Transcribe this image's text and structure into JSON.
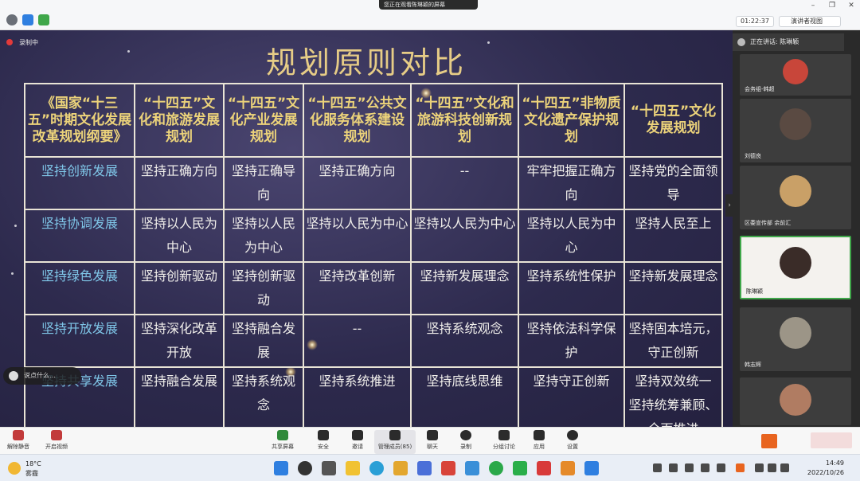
{
  "viewing_banner": "您正在观看陈琳颖的屏幕",
  "timer": "01:22:37",
  "view_mode": "演讲者视图",
  "recording": "录制中",
  "slide": {
    "title": "规划原则对比",
    "headers": [
      "《国家“十三五”时期文化发展改革规划纲要》",
      "“十四五”文化和旅游发展规划",
      "“十四五”文化产业发展规划",
      "“十四五”公共文化服务体系建设规划",
      "“十四五”文化和旅游科技创新规划",
      "“十四五”非物质文化遗产保护规划",
      "“十四五”文化发展规划"
    ],
    "rows": [
      [
        "坚持创新发展",
        "坚持正确方向",
        "坚持正确导向",
        "坚持正确方向",
        "--",
        "牢牢把握正确方向",
        "坚持党的全面领导"
      ],
      [
        "坚持协调发展",
        "坚持以人民为中心",
        "坚持以人民为中心",
        "坚持以人民为中心",
        "坚持以人民为中心",
        "坚持以人民为中心",
        "坚持人民至上"
      ],
      [
        "坚持绿色发展",
        "坚持创新驱动",
        "坚持创新驱动",
        "坚持改革创新",
        "坚持新发展理念",
        "坚持系统性保护",
        "坚持新发展理念"
      ],
      [
        "坚持开放发展",
        "坚持深化改革开放",
        "坚持融合发展",
        "--",
        "坚持系统观念",
        "坚持依法科学保护",
        "坚持固本培元，守正创新"
      ],
      [
        "坚持共享发展",
        "坚持融合发展",
        "坚持系统观念",
        "坚持系统推进",
        "坚持底线思维",
        "坚持守正创新",
        "坚持双效统一 坚持统筹兼顾、全面推进"
      ]
    ]
  },
  "chat_pill": "说点什么…",
  "speaking": "正在讲话: 陈琳颖",
  "participants": [
    {
      "name": "会务组-韩超"
    },
    {
      "name": "刘德良"
    },
    {
      "name": "区委宣传部 余前汇"
    },
    {
      "name": "陈琳颖"
    },
    {
      "name": "韩志辉"
    },
    {
      "name": ""
    }
  ],
  "toolbar_left": [
    {
      "label": "解除静音",
      "icon": "mic-muted-icon"
    },
    {
      "label": "开启视频",
      "icon": "video-off-icon"
    }
  ],
  "toolbar_center": [
    {
      "label": "共享屏幕",
      "icon": "share-screen-icon"
    },
    {
      "label": "安全",
      "icon": "shield-icon"
    },
    {
      "label": "邀请",
      "icon": "invite-icon"
    },
    {
      "label": "管理成员(85)",
      "icon": "members-icon"
    },
    {
      "label": "聊天",
      "icon": "chat-icon"
    },
    {
      "label": "录制",
      "icon": "record-icon"
    },
    {
      "label": "分组讨论",
      "icon": "breakout-icon"
    },
    {
      "label": "应用",
      "icon": "apps-icon"
    },
    {
      "label": "设置",
      "icon": "settings-icon"
    }
  ],
  "weather": {
    "temp": "18°C",
    "desc": "雾霾"
  },
  "clock": {
    "time": "14:49",
    "date": "2022/10/26"
  },
  "colors": {
    "slide_bg": "#2d2a4d",
    "header_text": "#ecd37a",
    "first_col_text": "#7fc6e8",
    "title": "#e6cc86"
  }
}
